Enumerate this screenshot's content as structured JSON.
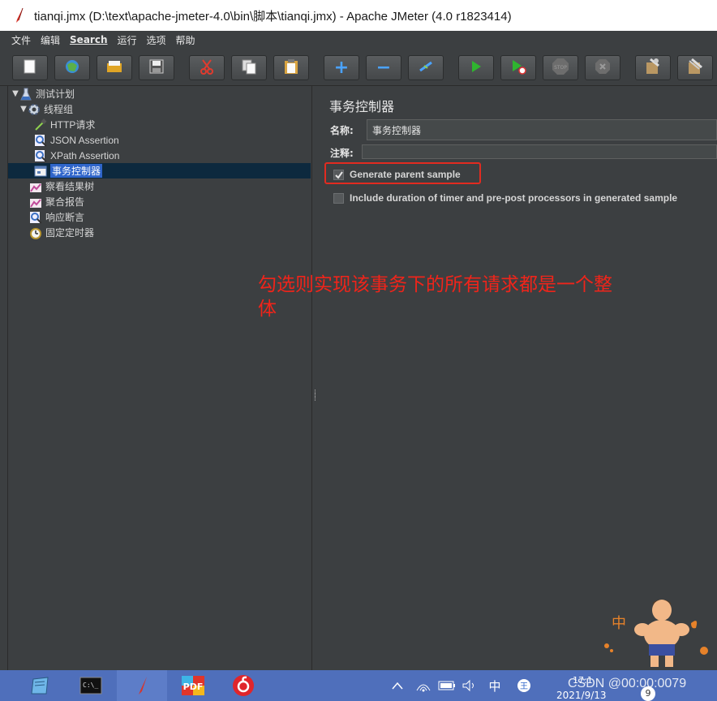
{
  "window": {
    "title": "tianqi.jmx (D:\\text\\apache-jmeter-4.0\\bin\\脚本\\tianqi.jmx) - Apache JMeter (4.0 r1823414)"
  },
  "menu": {
    "items": [
      "文件",
      "编辑",
      "Search",
      "运行",
      "选项",
      "帮助"
    ]
  },
  "toolbar": {
    "buttons": [
      "new-icon",
      "templates-icon",
      "open-icon",
      "save-icon",
      "cut-icon",
      "copy-icon",
      "paste-icon",
      "expand-icon",
      "collapse-icon",
      "toggle-icon",
      "start-icon",
      "start-no-pause-icon",
      "stop-icon",
      "shutdown-icon",
      "clear-icon",
      "clear-all-icon"
    ]
  },
  "tree": {
    "items": [
      {
        "label": "测试计划",
        "icon": "test-plan-icon"
      },
      {
        "label": "线程组",
        "icon": "gear-icon"
      },
      {
        "label": "HTTP请求",
        "icon": "pipette-icon"
      },
      {
        "label": "JSON Assertion",
        "icon": "magnifier-icon"
      },
      {
        "label": "XPath Assertion",
        "icon": "magnifier-icon"
      },
      {
        "label": "事务控制器",
        "icon": "controller-icon"
      },
      {
        "label": "察看结果树",
        "icon": "listener-icon"
      },
      {
        "label": "聚合报告",
        "icon": "listener-icon"
      },
      {
        "label": "响应断言",
        "icon": "magnifier-icon"
      },
      {
        "label": "固定定时器",
        "icon": "timer-icon"
      }
    ],
    "selected": "事务控制器"
  },
  "panel": {
    "title": "事务控制器",
    "name_label": "名称:",
    "name_value": "事务控制器",
    "comment_label": "注释:",
    "comment_value": "",
    "checkbox1_label": "Generate parent sample",
    "checkbox1_checked": true,
    "checkbox2_label": "Include duration of timer and pre-post processors in generated sample",
    "checkbox2_checked": false
  },
  "annotation": {
    "text": "勾选则实现该事务下的所有请求都是一个整体",
    "color": "#f0241a"
  },
  "taskbar": {
    "ime_label": "中",
    "clock_time": "17:1",
    "clock_date": "2021/9/13",
    "badge": "9",
    "watermark": "CSDN @00:00:0079",
    "pdf_label": "PDF"
  },
  "colors": {
    "background": "#3c3f41",
    "selection": "#2f65ca",
    "highlight_box": "#e22b20",
    "taskbar": "#4f6fbb"
  }
}
